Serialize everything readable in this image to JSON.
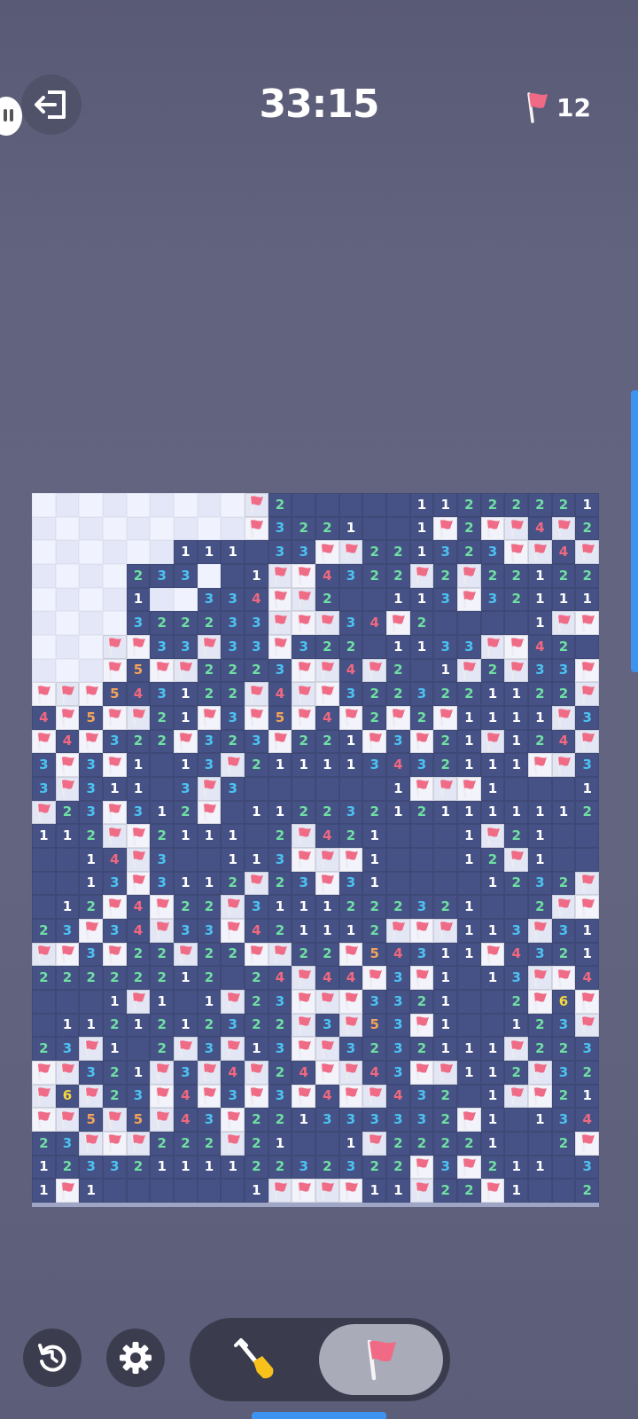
{
  "timer": "33:15",
  "flag_counter": {
    "icon": "flag-icon",
    "value": "12"
  },
  "controls": {
    "exit": "exit-icon",
    "restart": "restart-icon",
    "settings": "gear-icon",
    "mode_toggle": {
      "dig": "shovel-icon",
      "flag": "flag-icon",
      "selected": "flag"
    }
  },
  "board": {
    "columns": 24,
    "rows": 30,
    "legend": "'.'=unrevealed, '_'=revealed empty (no number), 'F'=flag, digits=adjacent mine count",
    "cells": [
      ".........F2_____112222211",
      ".........F3221__1F2FF4F2",
      "......111_33FF221323FF4F2",
      "....233._1FF4322F2F221222",
      "....1..334FF2__113F32111F",
      "....322233FFF34F2____1FF5FF111",
      "...FF33F33F322_1133FF42",
      "...F5FF2223FF4F2_1F2F33F21",
      "FFF543122F4FF3223221122F3F1",
      "4F5FF21F3F5F4F2F2F1111F32",
      "F4F322F323F221F3F21F124F2",
      "3F3F1_13F211113432111FF3",
      "3F311_3F3______1FFF1___13F31",
      "F23F312F_112232121111112F",
      "112FF2111_2F421___1F21__11",
      "__14F3__113FFF1___12F1",
      "__13F3112F23F31____1232F1",
      "_12F4F22F3111222321__2FF1",
      "23F34F33F421112FFF113F31",
      "FF3F22F22FF22F54311F4321",
      "22222212_24F44F3F1_13FF4F",
      "___1F1_1F23FFF3321__2F6FF",
      "_1121212322F3F53F1__123FF4",
      "23F1_2F3F13FF3232111F223F",
      "FF321F3F4F24FF43FF112F3221",
      "F6F23F4F3F3F4FF432_1FF21",
      "FF5F5F43F221333332F1_134F1",
      "23FFF222F21__1F22221__2F31",
      "1233211112232322F3F211_3F3",
      "1F1______1FFFF11F22F1__2F2"
    ]
  }
}
